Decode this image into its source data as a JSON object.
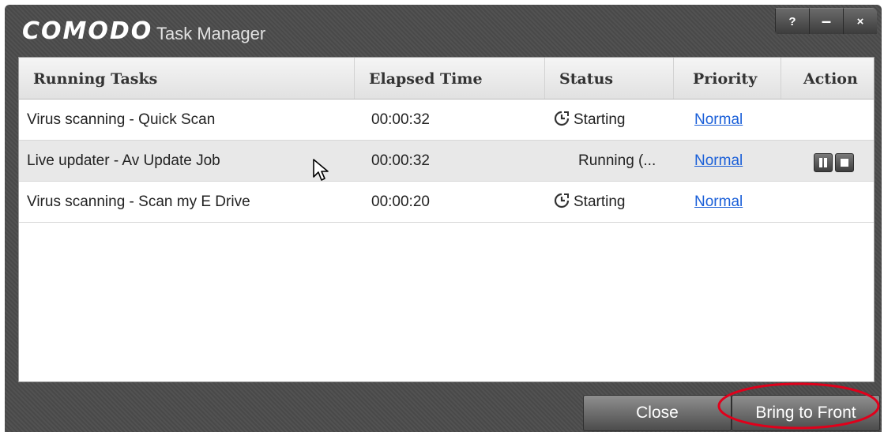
{
  "app": {
    "brand": "COMODO",
    "title": "Task Manager"
  },
  "window_controls": {
    "help": "?",
    "minimize": "–",
    "close": "×"
  },
  "table": {
    "columns": [
      "Running Tasks",
      "Elapsed Time",
      "Status",
      "Priority",
      "Action"
    ],
    "rows": [
      {
        "task": "Virus scanning - Quick Scan",
        "elapsed": "00:00:32",
        "status": "Starting",
        "status_icon": "clock-icon",
        "priority": "Normal",
        "actions": []
      },
      {
        "task": "Live updater - Av Update Job",
        "elapsed": "00:00:32",
        "status": "Running (...",
        "status_icon": "",
        "priority": "Normal",
        "actions": [
          "pause-icon",
          "stop-icon"
        ]
      },
      {
        "task": "Virus scanning - Scan my E Drive",
        "elapsed": "00:00:20",
        "status": "Starting",
        "status_icon": "clock-icon",
        "priority": "Normal",
        "actions": []
      }
    ]
  },
  "footer": {
    "close_label": "Close",
    "bring_to_front_label": "Bring to Front"
  },
  "colors": {
    "window_bg": "#4c4c4c",
    "link": "#1a5fd8",
    "highlight": "#e0001b"
  }
}
